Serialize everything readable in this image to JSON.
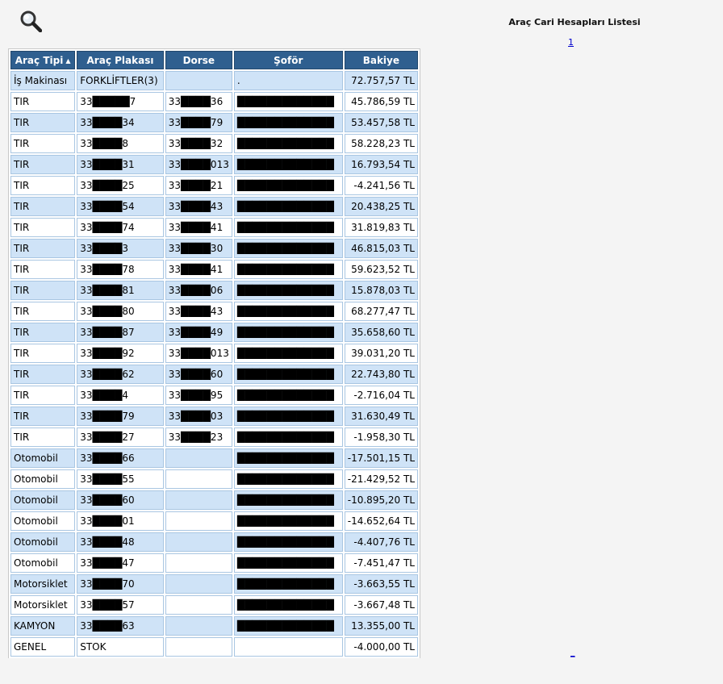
{
  "header": {
    "title": "Araç Cari Hesapları Listesi",
    "pager_top": "1",
    "pager_bottom": "_",
    "search_icon": "magnifier-icon"
  },
  "table": {
    "columns": [
      "Araç Tipi",
      "Araç Plakası",
      "Dorse",
      "Şoför",
      "Bakiye"
    ],
    "sort_indicator": "▲",
    "rows": [
      [
        "İş Makinası",
        "FORKLİFTLER(3)",
        "",
        ".",
        "72.757,57 TL"
      ],
      [
        "TIR",
        "33█████7",
        "33████36",
        "█████████████",
        "45.786,59 TL"
      ],
      [
        "TIR",
        "33████34",
        "33████79",
        "█████████████",
        "53.457,58 TL"
      ],
      [
        "TIR",
        "33████8",
        "33████32",
        "█████████████",
        "58.228,23 TL"
      ],
      [
        "TIR",
        "33████31",
        "33████013",
        "█████████████",
        "16.793,54 TL"
      ],
      [
        "TIR",
        "33████25",
        "33████21",
        "█████████████",
        "-4.241,56 TL"
      ],
      [
        "TIR",
        "33████54",
        "33████43",
        "█████████████",
        "20.438,25 TL"
      ],
      [
        "TIR",
        "33████74",
        "33████41",
        "█████████████",
        "31.819,83 TL"
      ],
      [
        "TIR",
        "33████3",
        "33████30",
        "█████████████",
        "46.815,03 TL"
      ],
      [
        "TIR",
        "33████78",
        "33████41",
        "█████████████",
        "59.623,52 TL"
      ],
      [
        "TIR",
        "33████81",
        "33████06",
        "█████████████",
        "15.878,03 TL"
      ],
      [
        "TIR",
        "33████80",
        "33████43",
        "█████████████",
        "68.277,47 TL"
      ],
      [
        "TIR",
        "33████87",
        "33████49",
        "█████████████",
        "35.658,60 TL"
      ],
      [
        "TIR",
        "33████92",
        "33████013",
        "█████████████",
        "39.031,20 TL"
      ],
      [
        "TIR",
        "33████62",
        "33████60",
        "█████████████",
        "22.743,80 TL"
      ],
      [
        "TIR",
        "33████4",
        "33████95",
        "█████████████",
        "-2.716,04 TL"
      ],
      [
        "TIR",
        "33████79",
        "33████03",
        "█████████████",
        "31.630,49 TL"
      ],
      [
        "TIR",
        "33████27",
        "33████23",
        "█████████████",
        "-1.958,30 TL"
      ],
      [
        "Otomobil",
        "33████66",
        "",
        "█████████████",
        "-17.501,15 TL"
      ],
      [
        "Otomobil",
        "33████55",
        "",
        "█████████████",
        "-21.429,52 TL"
      ],
      [
        "Otomobil",
        "33████60",
        "",
        "█████████████",
        "-10.895,20 TL"
      ],
      [
        "Otomobil",
        "33████01",
        "",
        "█████████████",
        "-14.652,64 TL"
      ],
      [
        "Otomobil",
        "33████48",
        "",
        "█████████████",
        "-4.407,76 TL"
      ],
      [
        "Otomobil",
        "33████47",
        "",
        "█████████████",
        "-7.451,47 TL"
      ],
      [
        "Motorsiklet",
        "33████70",
        "",
        "█████████████",
        "-3.663,55 TL"
      ],
      [
        "Motorsiklet",
        "33████57",
        "",
        "█████████████",
        "-3.667,48 TL"
      ],
      [
        "KAMYON",
        "33████63",
        "",
        "█████████████",
        "13.355,00 TL"
      ],
      [
        "GENEL",
        "STOK",
        "",
        "",
        "-4.000,00 TL"
      ]
    ]
  },
  "colors": {
    "header_bg": "#2f5f8f",
    "row_alt_bg": "#cfe3f7",
    "link": "#0000cc"
  }
}
